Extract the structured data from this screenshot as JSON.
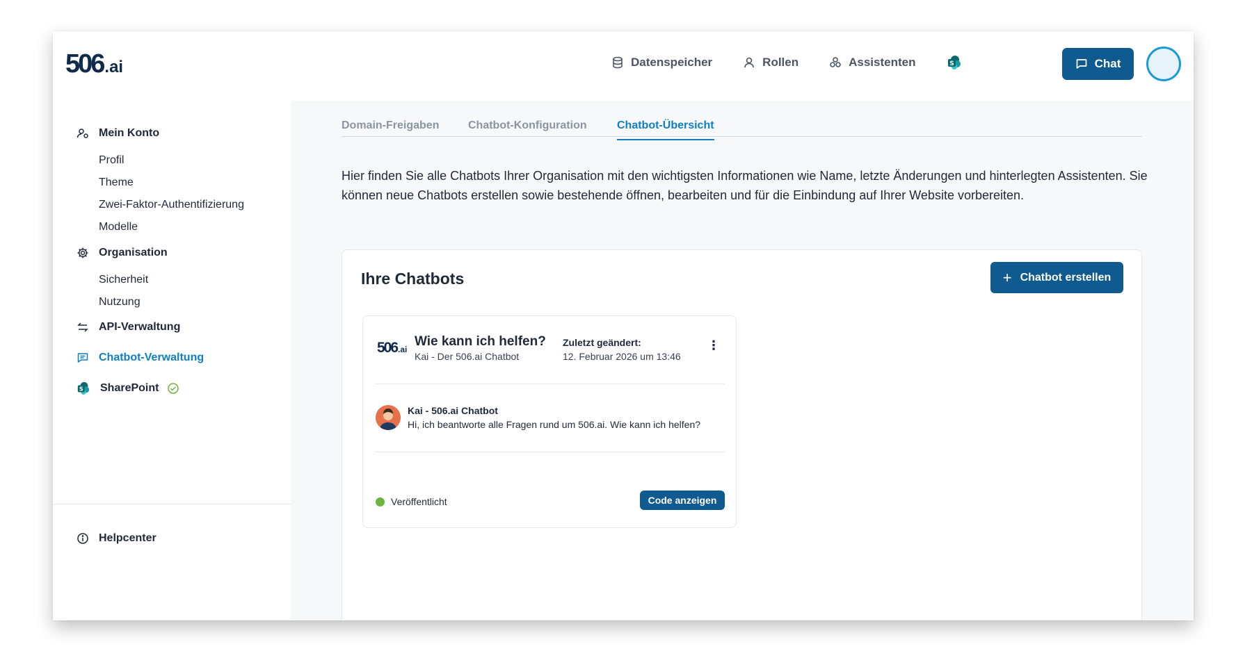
{
  "brand": {
    "logo_main": "506",
    "logo_suffix": ".ai",
    "accent": "#0f5a8f",
    "link_color": "#0f7fc2"
  },
  "topnav": {
    "items": [
      {
        "label": "Datenspeicher",
        "icon": "database-icon"
      },
      {
        "label": "Rollen",
        "icon": "user-icon"
      },
      {
        "label": "Assistenten",
        "icon": "assistants-icon"
      }
    ],
    "sharepoint_icon": "sharepoint-icon",
    "chat_label": "Chat"
  },
  "sidebar": {
    "sections": [
      {
        "label": "Mein Konto",
        "icon": "account-icon",
        "items": [
          "Profil",
          "Theme",
          "Zwei-Faktor-Authentifizierung",
          "Modelle"
        ]
      },
      {
        "label": "Organisation",
        "icon": "gear-icon",
        "items": [
          "Sicherheit",
          "Nutzung"
        ]
      },
      {
        "label": "API-Verwaltung",
        "icon": "swap-arrows-icon",
        "items": []
      },
      {
        "label": "Chatbot-Verwaltung",
        "icon": "chat-icon",
        "items": [],
        "active": true
      },
      {
        "label": "SharePoint",
        "icon": "sharepoint-icon",
        "items": [],
        "status_icon": "check-circle-icon"
      }
    ],
    "help": {
      "label": "Helpcenter",
      "icon": "info-icon"
    }
  },
  "tabs": [
    {
      "label": "Domain-Freigaben",
      "active": false
    },
    {
      "label": "Chatbot-Konfiguration",
      "active": false
    },
    {
      "label": "Chatbot-Übersicht",
      "active": true
    }
  ],
  "intro": "Hier finden Sie alle Chatbots Ihrer Organisation mit den wichtigsten Informationen wie Name, letzte Änderungen und hinterlegten Assistenten. Sie können neue Chatbots erstellen sowie bestehende öffnen, bearbeiten und für die Einbindung auf Ihrer Website vorbereiten.",
  "panel": {
    "title": "Ihre Chatbots",
    "create_label": "Chatbot erstellen",
    "create_icon": "plus-icon"
  },
  "card": {
    "logo_main": "506",
    "logo_suffix": ".ai",
    "title": "Wie kann ich helfen?",
    "subtitle": "Kai - Der 506.ai Chatbot",
    "changed_label": "Zuletzt geändert:",
    "changed_value": "12. Februar 2026 um 13:46",
    "menu_icon": "more-vertical-icon",
    "bot_name": "Kai - 506.ai Chatbot",
    "bot_message": "Hi, ich beantworte alle Fragen rund um 506.ai. Wie kann ich helfen?",
    "status": "Veröffentlicht",
    "status_color": "#6cb33f",
    "code_label": "Code anzeigen"
  }
}
